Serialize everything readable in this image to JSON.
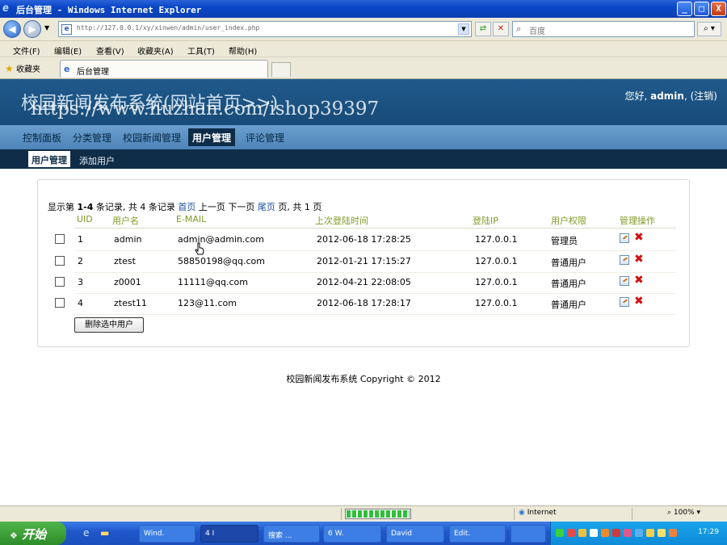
{
  "window": {
    "title": "后台管理 - Windows Internet Explorer",
    "controls": [
      "_",
      "□",
      "X"
    ]
  },
  "browser": {
    "address": "http://127.0.0.1/xy/xinwen/admin/user_index.php",
    "search_placeholder": "百度",
    "menu": [
      "文件(F)",
      "编辑(E)",
      "查看(V)",
      "收藏夹(A)",
      "工具(T)",
      "帮助(H)"
    ],
    "favorites_label": "收藏夹",
    "tab_title": "后台管理",
    "status_zone": "Internet",
    "zoom": "100%"
  },
  "header": {
    "site_title": "校园新闻发布系统(网站首页>>)",
    "greeting_prefix": "您好,",
    "username": "admin",
    "logout": "(注销)",
    "watermark": "https://www.huzhan.com/ishop39397"
  },
  "nav": {
    "main": [
      "控制面板",
      "分类管理",
      "校园新闻管理",
      "用户管理",
      "评论管理"
    ],
    "sub": [
      "用户管理",
      "添加用户"
    ]
  },
  "pager": {
    "prefix": "显示第",
    "range": "1-4",
    "mid": "条记录, 共",
    "total": "4",
    "suffix": "条记录",
    "first": "首页",
    "prev": "上一页",
    "next": "下一页",
    "last": "尾页",
    "pages_prefix": "页, 共",
    "pages": "1",
    "pages_suffix": "页"
  },
  "table": {
    "headers": [
      "UID",
      "用户名",
      "E-MAIL",
      "上次登陆时间",
      "登陆IP",
      "用户权限",
      "管理操作"
    ],
    "rows": [
      {
        "uid": "1",
        "name": "admin",
        "email": "admin@admin.com",
        "last_login": "2012-06-18 17:28:25",
        "ip": "127.0.0.1",
        "role": "管理员"
      },
      {
        "uid": "2",
        "name": "ztest",
        "email": "58850198@qq.com",
        "last_login": "2012-01-21 17:15:27",
        "ip": "127.0.0.1",
        "role": "普通用户"
      },
      {
        "uid": "3",
        "name": "z0001",
        "email": "11111@qq.com",
        "last_login": "2012-04-21 22:08:05",
        "ip": "127.0.0.1",
        "role": "普通用户"
      },
      {
        "uid": "4",
        "name": "ztest11",
        "email": "123@11.com",
        "last_login": "2012-06-18 17:28:17",
        "ip": "127.0.0.1",
        "role": "普通用户"
      }
    ],
    "delete_selected": "删除选中用户"
  },
  "footer": "校园新闻发布系统 Copyright © 2012",
  "taskbar": {
    "start": "开始",
    "items": [
      "Wind.",
      "4 I",
      "搜索 ...",
      "6 W.",
      "David",
      "Edit."
    ],
    "clock": "17:29"
  },
  "colors": {
    "header_bg": "#1f5a8c",
    "mainnav_bg": "#5a8fc3",
    "subnav_bg": "#0f2d48",
    "th_text": "#7c9b27",
    "link": "#1b4ea0",
    "delete_icon": "#d01010"
  }
}
